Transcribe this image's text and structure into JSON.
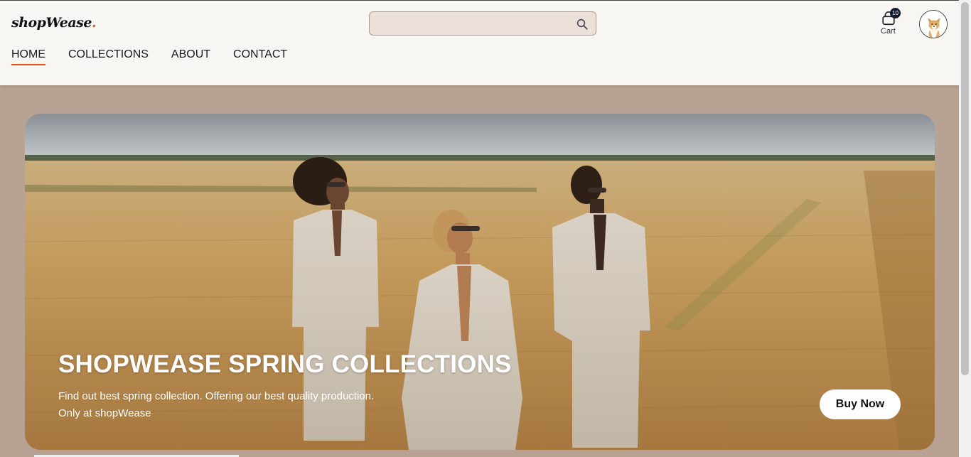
{
  "brand": {
    "name": "shopWease",
    "dot": "."
  },
  "search": {
    "placeholder": "",
    "value": ""
  },
  "cart": {
    "label": "Cart",
    "count": "10"
  },
  "nav": {
    "items": [
      {
        "label": "HOME",
        "active": true
      },
      {
        "label": "COLLECTIONS",
        "active": false
      },
      {
        "label": "ABOUT",
        "active": false
      },
      {
        "label": "CONTACT",
        "active": false
      }
    ]
  },
  "hero": {
    "title": "SHOPWEASE SPRING COLLECTIONS",
    "subtitle_line1": "Find out best spring collection. Offering our best quality production.",
    "subtitle_line2": "Only at shopWease",
    "button_label": "Buy Now"
  },
  "colors": {
    "accent": "#e0531b",
    "header_bg": "#f8f6f3",
    "page_bg": "#b8a293",
    "badge_bg": "#151a33"
  },
  "icons": [
    "search-icon",
    "cart-icon",
    "avatar-dog-icon"
  ]
}
